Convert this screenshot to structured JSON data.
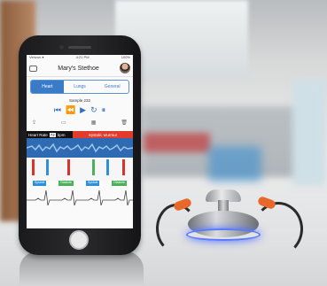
{
  "app": {
    "status_left": "Verizon ▾",
    "status_time": "4:21 PM",
    "status_right": "100%",
    "title": "Mary's Stethoe",
    "tabs": [
      "Heart",
      "Lungs",
      "General"
    ],
    "sample_label": "Sample 232",
    "heart_rate_label": "Heart Rate",
    "heart_rate_value": "72",
    "heart_rate_unit": "bpm",
    "marker_label": "Systolic Murmur",
    "phase_labels": [
      "Systole",
      "Diastole",
      "Systole",
      "Diastole"
    ]
  },
  "colors": {
    "accent": "#3a7bc8",
    "alert": "#e23b2c",
    "marker_red": "#d9342b",
    "marker_green": "#4bb25b",
    "marker_blue": "#2f8fd8",
    "glow": "#5a7bff",
    "earpiece": "#e8672a"
  },
  "icons": {
    "controls": [
      "skip-back-icon",
      "rewind-icon",
      "play-icon",
      "repeat-icon",
      "pause-icon"
    ],
    "tools": [
      "share-icon",
      "folder-icon",
      "calendar-icon",
      "trash-icon"
    ]
  }
}
